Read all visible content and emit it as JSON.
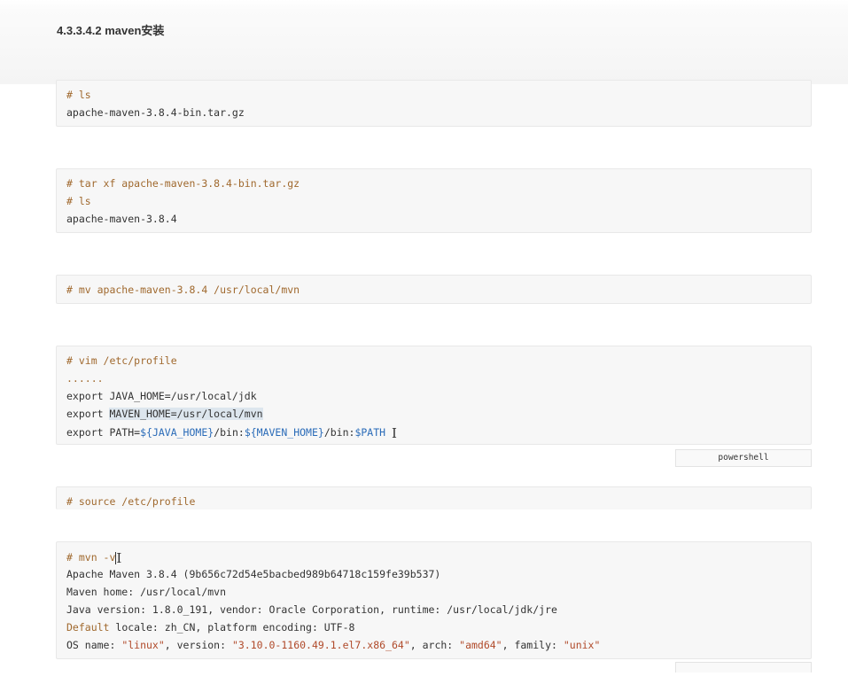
{
  "section": {
    "title": "4.3.3.4.2 maven安装"
  },
  "blocks": [
    {
      "lines": [
        "# ls",
        "apache-maven-3.8.4-bin.tar.gz"
      ]
    },
    {
      "lines": [
        "# tar xf apache-maven-3.8.4-bin.tar.gz",
        "# ls",
        "apache-maven-3.8.4"
      ]
    },
    {
      "lines": [
        "# mv apache-maven-3.8.4 /usr/local/mvn"
      ]
    },
    {
      "lines": {
        "l1": "# vim /etc/profile",
        "l2": "......",
        "l3": "export JAVA_HOME=/usr/local/jdk",
        "l4_a": "export ",
        "l4_b": "MAVEN_HOME=/usr/local/mvn",
        "l5_a": "export PATH=",
        "l5_b": "${JAVA_HOME}",
        "l5_c": "/bin:",
        "l5_d": "${MAVEN_HOME}",
        "l5_e": "/bin:",
        "l5_f": "$PATH"
      },
      "language": "powershell"
    },
    {
      "lines": [
        "# source /etc/profile"
      ]
    },
    {
      "lines": {
        "l1": "# mvn -v",
        "l2": "Apache Maven 3.8.4 (9b656c72d54e5bacbed989b64718c159fe39b537)",
        "l3": "Maven home: /usr/local/mvn",
        "l4": "Java version: 1.8.0_191, vendor: Oracle Corporation, runtime: /usr/local/jdk/jre",
        "l5_kw": "Default",
        "l5_rest": " locale: zh_CN, platform encoding: UTF-8",
        "l6_a": "OS name: ",
        "l6_b": "\"linux\"",
        "l6_c": ", version: ",
        "l6_d": "\"3.10.0-1160.49.1.el7.x86_64\"",
        "l6_e": ", arch: ",
        "l6_f": "\"amd64\"",
        "l6_g": ", family: ",
        "l6_h": "\"unix\""
      }
    }
  ],
  "cursor_glyph": "I"
}
